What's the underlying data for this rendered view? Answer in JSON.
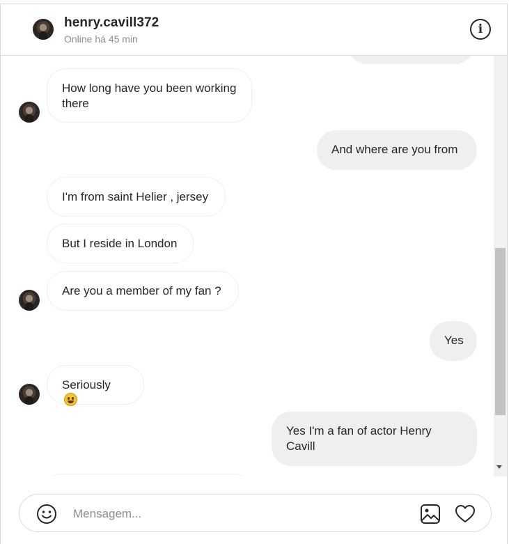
{
  "header": {
    "username": "henry.cavill372",
    "status": "Online há 45 min",
    "info_icon": "info-icon"
  },
  "messages": [
    {
      "side": "in",
      "text": "How long have you been working there"
    },
    {
      "side": "out",
      "text": "And where are you from"
    },
    {
      "side": "in",
      "text": "I'm from saint Helier , jersey"
    },
    {
      "side": "in",
      "text": "But I reside in London"
    },
    {
      "side": "in",
      "text": "Are you a member of my fan ?"
    },
    {
      "side": "out",
      "text": "Yes"
    },
    {
      "side": "in",
      "text": "Seriously",
      "emoji": "grinning-face-emoji"
    },
    {
      "side": "out",
      "text": "Yes I'm a fan of actor Henry Cavill"
    }
  ],
  "composer": {
    "placeholder": "Mensagem...",
    "icons": [
      "emoji-icon",
      "image-icon",
      "heart-icon"
    ]
  },
  "colors": {
    "outgoing_bubble": "#efefef",
    "incoming_border": "#efefef",
    "text": "#262626",
    "muted": "#8e8e8e",
    "divider": "#dbdbdb"
  }
}
